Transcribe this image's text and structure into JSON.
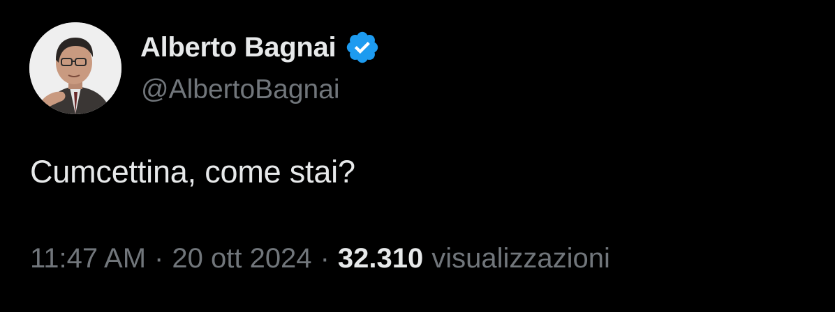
{
  "author": {
    "display_name": "Alberto Bagnai",
    "handle": "@AlbertoBagnai",
    "verified": true,
    "verified_color": "#1d9bf0",
    "avatar_icon": "profile-photo"
  },
  "tweet": {
    "text": "Cumcettina, come stai?"
  },
  "meta": {
    "time": "11:47 AM",
    "separator": "·",
    "date": "20 ott 2024",
    "views_count": "32.310",
    "views_label": "visualizzazioni"
  },
  "colors": {
    "background": "#000000",
    "primary_text": "#e7e9ea",
    "secondary_text": "#71767b"
  }
}
